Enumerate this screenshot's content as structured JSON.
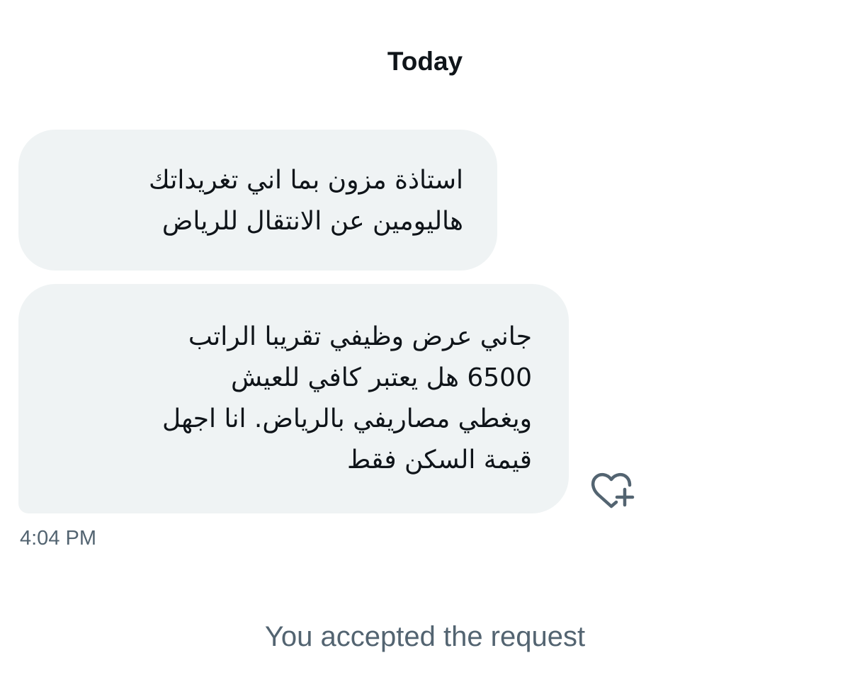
{
  "conversation": {
    "date_header": "Today",
    "messages": [
      {
        "lines": [
          "استاذة مزون بما اني تغريداتك",
          "هاليومين عن الانتقال للرياض"
        ]
      },
      {
        "lines": [
          "جاني عرض وظيفي تقريبا الراتب",
          "6500  هل يعتبر كافي للعيش",
          "ويغطي مصاريفي بالرياض. انا اجهل",
          "قيمة السكن فقط"
        ]
      }
    ],
    "timestamp": "4:04 PM",
    "react_icon": "heart-plus-icon",
    "system_message": "You accepted the request"
  },
  "colors": {
    "bubble_background": "#eff3f4",
    "primary_text": "#0f1419",
    "secondary_text": "#536471"
  }
}
